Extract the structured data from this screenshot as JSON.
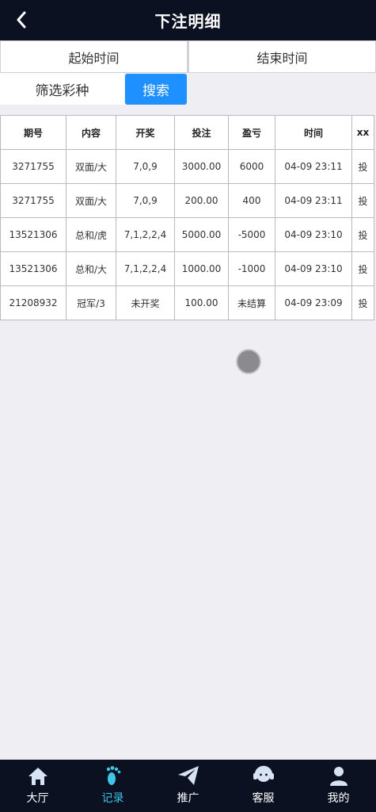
{
  "header": {
    "title": "下注明细"
  },
  "date": {
    "start_label": "起始时间",
    "end_label": "结束时间"
  },
  "filter": {
    "lottery_label": "筛选彩种",
    "search_label": "搜索"
  },
  "table": {
    "columns": [
      "期号",
      "内容",
      "开奖",
      "投注",
      "盈亏",
      "时间",
      "xx"
    ],
    "rows": [
      [
        "3271755",
        "双面/大",
        "7,0,9",
        "3000.00",
        "6000",
        "04-09 23:11",
        "投"
      ],
      [
        "3271755",
        "双面/大",
        "7,0,9",
        "200.00",
        "400",
        "04-09 23:11",
        "投"
      ],
      [
        "13521306",
        "总和/虎",
        "7,1,2,2,4",
        "5000.00",
        "-5000",
        "04-09 23:10",
        "投"
      ],
      [
        "13521306",
        "总和/大",
        "7,1,2,2,4",
        "1000.00",
        "-1000",
        "04-09 23:10",
        "投"
      ],
      [
        "21208932",
        "冠军/3",
        "未开奖",
        "100.00",
        "未结算",
        "04-09 23:09",
        "投"
      ]
    ]
  },
  "colors": {
    "accent": "#1e90ff",
    "header_bg": "#0b1120",
    "profit": "#d0021b",
    "loss": "#1a9a1a",
    "tab_active": "#3fc6e6"
  },
  "tabbar": {
    "items": [
      {
        "label": "大厅",
        "icon": "home-icon"
      },
      {
        "label": "记录",
        "icon": "footprint-icon"
      },
      {
        "label": "推广",
        "icon": "paper-plane-icon"
      },
      {
        "label": "客服",
        "icon": "headset-icon"
      },
      {
        "label": "我的",
        "icon": "user-icon"
      }
    ]
  }
}
